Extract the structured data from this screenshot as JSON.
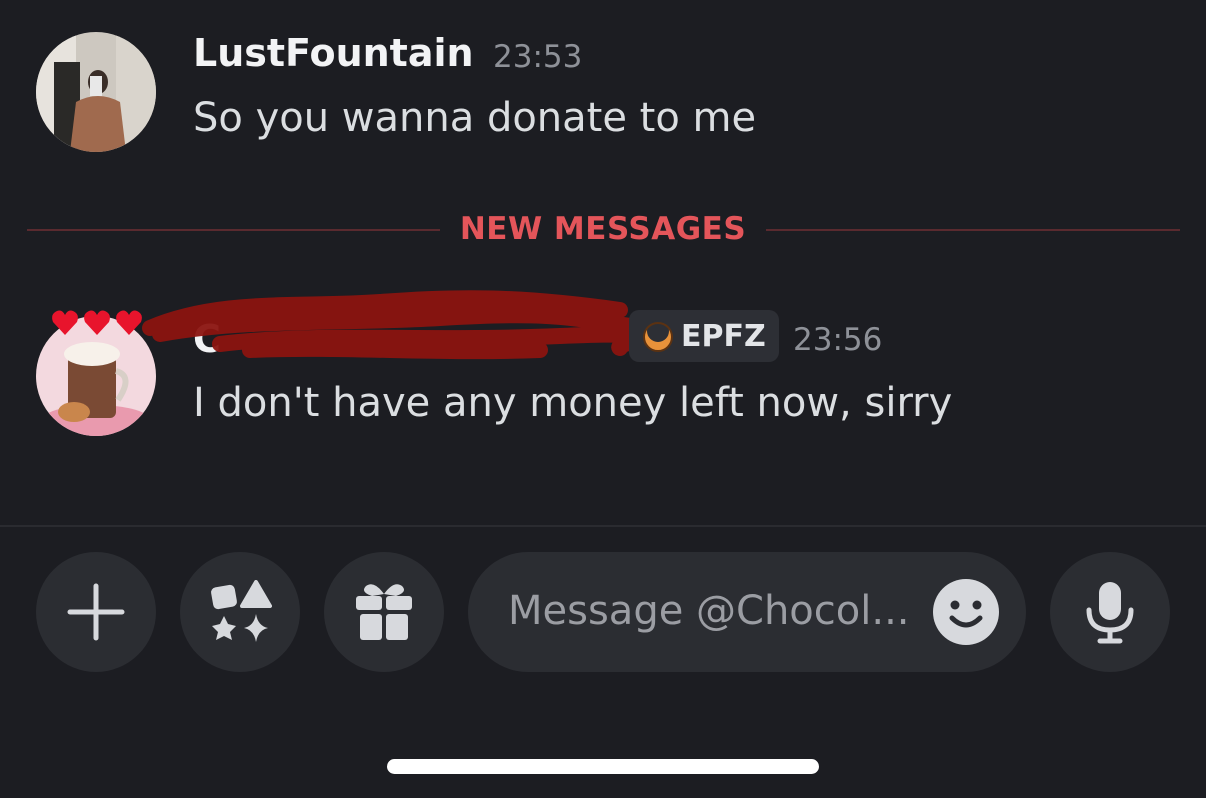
{
  "messages": [
    {
      "username": "LustFountain",
      "timestamp": "23:53",
      "text": "So you wanna donate to me"
    },
    {
      "username": "C",
      "tag": "EPFZ",
      "tag_icon": "moon-icon",
      "timestamp": "23:56",
      "text": "I don't have any money left now, sirry",
      "decoration": "hearts"
    }
  ],
  "divider": {
    "label": "NEW MESSAGES",
    "color": "#e4555a"
  },
  "composer": {
    "placeholder": "Message @Chocol...",
    "buttons": [
      "plus-icon",
      "apps-icon",
      "gift-icon",
      "emoji-icon",
      "microphone-icon"
    ]
  },
  "colors": {
    "background": "#1c1d22",
    "button": "#2b2d32",
    "redaction": "#8b1410"
  }
}
